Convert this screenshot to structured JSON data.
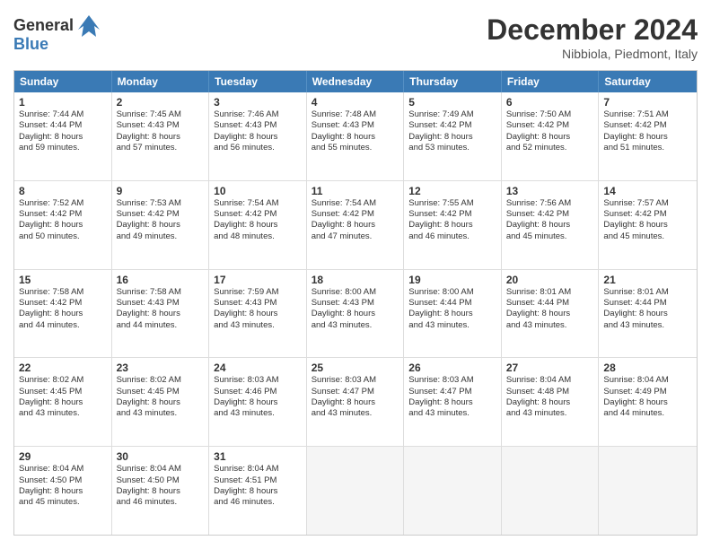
{
  "header": {
    "logo_general": "General",
    "logo_blue": "Blue",
    "month_title": "December 2024",
    "location": "Nibbiola, Piedmont, Italy"
  },
  "days_of_week": [
    "Sunday",
    "Monday",
    "Tuesday",
    "Wednesday",
    "Thursday",
    "Friday",
    "Saturday"
  ],
  "weeks": [
    [
      {
        "day": "1",
        "lines": [
          "Sunrise: 7:44 AM",
          "Sunset: 4:44 PM",
          "Daylight: 8 hours",
          "and 59 minutes."
        ]
      },
      {
        "day": "2",
        "lines": [
          "Sunrise: 7:45 AM",
          "Sunset: 4:43 PM",
          "Daylight: 8 hours",
          "and 57 minutes."
        ]
      },
      {
        "day": "3",
        "lines": [
          "Sunrise: 7:46 AM",
          "Sunset: 4:43 PM",
          "Daylight: 8 hours",
          "and 56 minutes."
        ]
      },
      {
        "day": "4",
        "lines": [
          "Sunrise: 7:48 AM",
          "Sunset: 4:43 PM",
          "Daylight: 8 hours",
          "and 55 minutes."
        ]
      },
      {
        "day": "5",
        "lines": [
          "Sunrise: 7:49 AM",
          "Sunset: 4:42 PM",
          "Daylight: 8 hours",
          "and 53 minutes."
        ]
      },
      {
        "day": "6",
        "lines": [
          "Sunrise: 7:50 AM",
          "Sunset: 4:42 PM",
          "Daylight: 8 hours",
          "and 52 minutes."
        ]
      },
      {
        "day": "7",
        "lines": [
          "Sunrise: 7:51 AM",
          "Sunset: 4:42 PM",
          "Daylight: 8 hours",
          "and 51 minutes."
        ]
      }
    ],
    [
      {
        "day": "8",
        "lines": [
          "Sunrise: 7:52 AM",
          "Sunset: 4:42 PM",
          "Daylight: 8 hours",
          "and 50 minutes."
        ]
      },
      {
        "day": "9",
        "lines": [
          "Sunrise: 7:53 AM",
          "Sunset: 4:42 PM",
          "Daylight: 8 hours",
          "and 49 minutes."
        ]
      },
      {
        "day": "10",
        "lines": [
          "Sunrise: 7:54 AM",
          "Sunset: 4:42 PM",
          "Daylight: 8 hours",
          "and 48 minutes."
        ]
      },
      {
        "day": "11",
        "lines": [
          "Sunrise: 7:54 AM",
          "Sunset: 4:42 PM",
          "Daylight: 8 hours",
          "and 47 minutes."
        ]
      },
      {
        "day": "12",
        "lines": [
          "Sunrise: 7:55 AM",
          "Sunset: 4:42 PM",
          "Daylight: 8 hours",
          "and 46 minutes."
        ]
      },
      {
        "day": "13",
        "lines": [
          "Sunrise: 7:56 AM",
          "Sunset: 4:42 PM",
          "Daylight: 8 hours",
          "and 45 minutes."
        ]
      },
      {
        "day": "14",
        "lines": [
          "Sunrise: 7:57 AM",
          "Sunset: 4:42 PM",
          "Daylight: 8 hours",
          "and 45 minutes."
        ]
      }
    ],
    [
      {
        "day": "15",
        "lines": [
          "Sunrise: 7:58 AM",
          "Sunset: 4:42 PM",
          "Daylight: 8 hours",
          "and 44 minutes."
        ]
      },
      {
        "day": "16",
        "lines": [
          "Sunrise: 7:58 AM",
          "Sunset: 4:43 PM",
          "Daylight: 8 hours",
          "and 44 minutes."
        ]
      },
      {
        "day": "17",
        "lines": [
          "Sunrise: 7:59 AM",
          "Sunset: 4:43 PM",
          "Daylight: 8 hours",
          "and 43 minutes."
        ]
      },
      {
        "day": "18",
        "lines": [
          "Sunrise: 8:00 AM",
          "Sunset: 4:43 PM",
          "Daylight: 8 hours",
          "and 43 minutes."
        ]
      },
      {
        "day": "19",
        "lines": [
          "Sunrise: 8:00 AM",
          "Sunset: 4:44 PM",
          "Daylight: 8 hours",
          "and 43 minutes."
        ]
      },
      {
        "day": "20",
        "lines": [
          "Sunrise: 8:01 AM",
          "Sunset: 4:44 PM",
          "Daylight: 8 hours",
          "and 43 minutes."
        ]
      },
      {
        "day": "21",
        "lines": [
          "Sunrise: 8:01 AM",
          "Sunset: 4:44 PM",
          "Daylight: 8 hours",
          "and 43 minutes."
        ]
      }
    ],
    [
      {
        "day": "22",
        "lines": [
          "Sunrise: 8:02 AM",
          "Sunset: 4:45 PM",
          "Daylight: 8 hours",
          "and 43 minutes."
        ]
      },
      {
        "day": "23",
        "lines": [
          "Sunrise: 8:02 AM",
          "Sunset: 4:45 PM",
          "Daylight: 8 hours",
          "and 43 minutes."
        ]
      },
      {
        "day": "24",
        "lines": [
          "Sunrise: 8:03 AM",
          "Sunset: 4:46 PM",
          "Daylight: 8 hours",
          "and 43 minutes."
        ]
      },
      {
        "day": "25",
        "lines": [
          "Sunrise: 8:03 AM",
          "Sunset: 4:47 PM",
          "Daylight: 8 hours",
          "and 43 minutes."
        ]
      },
      {
        "day": "26",
        "lines": [
          "Sunrise: 8:03 AM",
          "Sunset: 4:47 PM",
          "Daylight: 8 hours",
          "and 43 minutes."
        ]
      },
      {
        "day": "27",
        "lines": [
          "Sunrise: 8:04 AM",
          "Sunset: 4:48 PM",
          "Daylight: 8 hours",
          "and 43 minutes."
        ]
      },
      {
        "day": "28",
        "lines": [
          "Sunrise: 8:04 AM",
          "Sunset: 4:49 PM",
          "Daylight: 8 hours",
          "and 44 minutes."
        ]
      }
    ],
    [
      {
        "day": "29",
        "lines": [
          "Sunrise: 8:04 AM",
          "Sunset: 4:50 PM",
          "Daylight: 8 hours",
          "and 45 minutes."
        ]
      },
      {
        "day": "30",
        "lines": [
          "Sunrise: 8:04 AM",
          "Sunset: 4:50 PM",
          "Daylight: 8 hours",
          "and 46 minutes."
        ]
      },
      {
        "day": "31",
        "lines": [
          "Sunrise: 8:04 AM",
          "Sunset: 4:51 PM",
          "Daylight: 8 hours",
          "and 46 minutes."
        ]
      },
      {
        "empty": true
      },
      {
        "empty": true
      },
      {
        "empty": true
      },
      {
        "empty": true
      }
    ]
  ]
}
